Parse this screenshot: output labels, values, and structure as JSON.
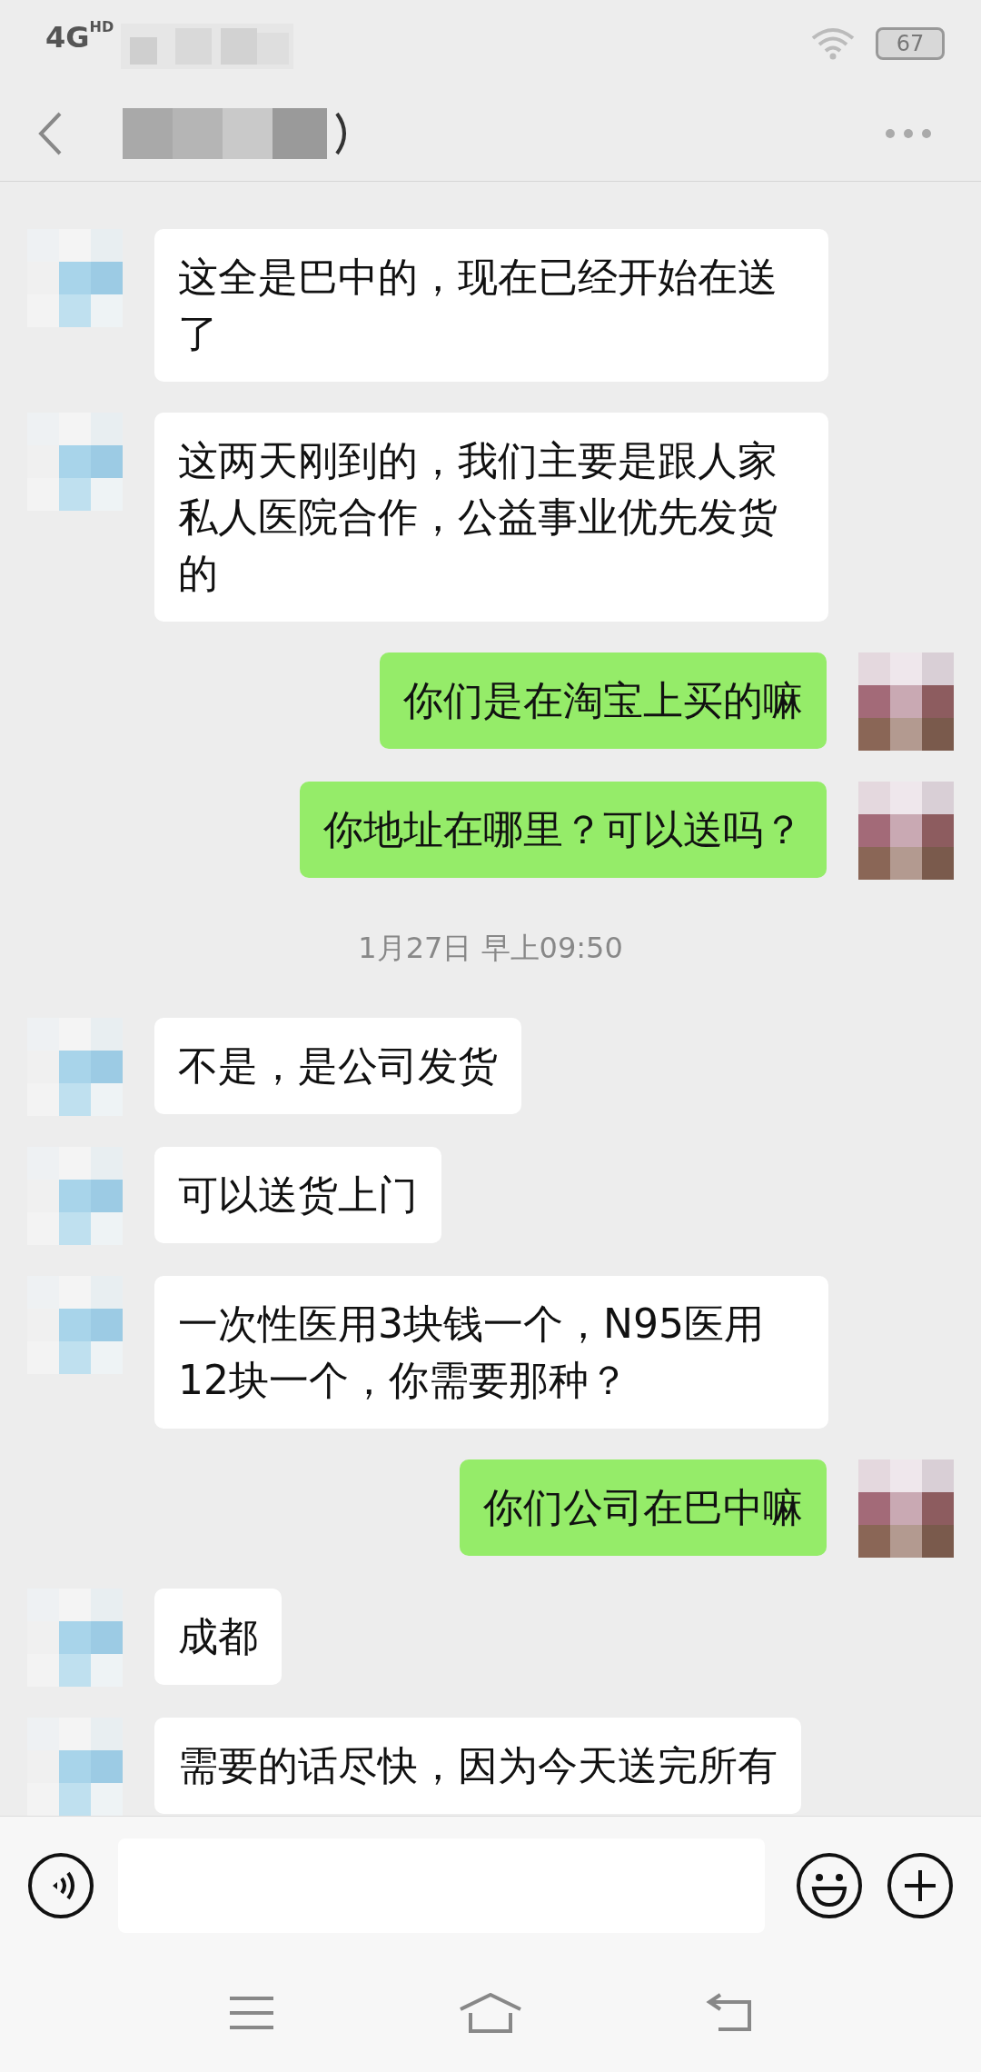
{
  "status_bar": {
    "network": "4G",
    "network_badge": "HD",
    "battery": "67"
  },
  "messages": [
    {
      "kind": "received",
      "text": "这全是巴中的，现在已经开始在送了"
    },
    {
      "kind": "received",
      "text": "这两天刚到的，我们主要是跟人家私人医院合作，公益事业优先发货的"
    },
    {
      "kind": "sent",
      "text": "你们是在淘宝上买的嘛"
    },
    {
      "kind": "sent",
      "text": "你地址在哪里？可以送吗？"
    },
    {
      "kind": "time",
      "text": "1月27日 早上09:50"
    },
    {
      "kind": "received",
      "text": "不是，是公司发货"
    },
    {
      "kind": "received",
      "text": "可以送货上门"
    },
    {
      "kind": "received",
      "text": "一次性医用3块钱一个，N95医用12块一个，你需要那种？"
    },
    {
      "kind": "sent",
      "text": "你们公司在巴中嘛"
    },
    {
      "kind": "received",
      "text": "成都"
    },
    {
      "kind": "received",
      "text": "需要的话尽快，因为今天送完所有"
    }
  ]
}
